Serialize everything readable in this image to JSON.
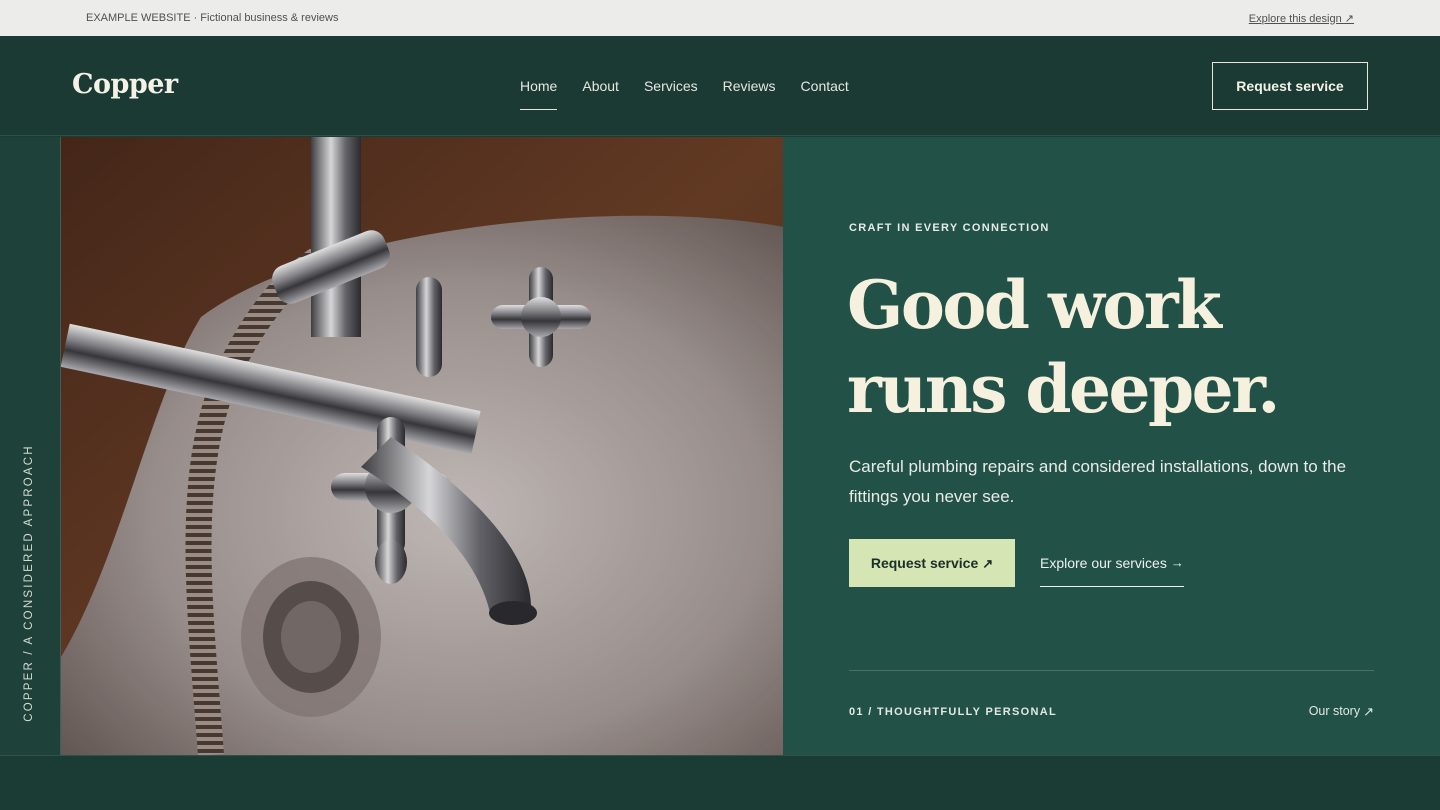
{
  "demo_bar": {
    "left_text": "EXAMPLE WEBSITE · Fictional business & reviews",
    "right_link": "Explore this design ↗"
  },
  "header": {
    "logo": "Copper",
    "nav": [
      {
        "label": "Home",
        "active": true
      },
      {
        "label": "About",
        "active": false
      },
      {
        "label": "Services",
        "active": false
      },
      {
        "label": "Reviews",
        "active": false
      },
      {
        "label": "Contact",
        "active": false
      }
    ],
    "cta_label": "Request service"
  },
  "side_rail": {
    "text": "COPPER / A CONSIDERED APPROACH"
  },
  "hero": {
    "image_alt_icon": "photo-faucet",
    "eyebrow": "CRAFT IN EVERY CONNECTION",
    "headline_line1": "Good work",
    "headline_line2": "runs deeper.",
    "subcopy": "Careful plumbing repairs and considered installations, down to the fittings you never see.",
    "primary_cta": "Request service",
    "primary_cta_icon": "↗",
    "secondary_cta": "Explore our services",
    "secondary_cta_icon": "→",
    "footer_label": "01 / THOUGHTFULLY PERSONAL",
    "story_link": "Our story",
    "story_link_icon": "↗"
  },
  "colors": {
    "header_bg": "#1a3a33",
    "hero_panel_bg": "#225148",
    "accent_button": "#d5e5b3",
    "headline": "#f6f1df"
  }
}
